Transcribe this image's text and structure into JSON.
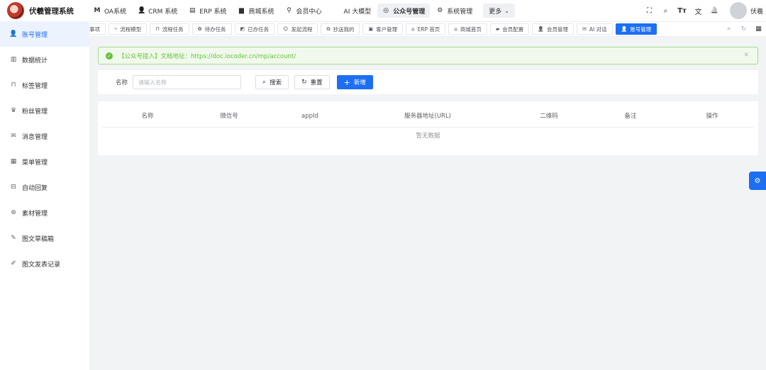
{
  "app": {
    "title": "伏羲管理系统"
  },
  "topnav": [
    {
      "icon": "m-icon",
      "glyph": "M",
      "label": "OA系统",
      "active": false
    },
    {
      "icon": "user-icon",
      "glyph": "👤",
      "label": "CRM 系统",
      "active": false
    },
    {
      "icon": "calendar-icon",
      "glyph": "▤",
      "label": "ERP 系统",
      "active": false
    },
    {
      "icon": "shop-icon",
      "glyph": "▆",
      "label": "商城系统",
      "active": false
    },
    {
      "icon": "bike-icon",
      "glyph": "⚲",
      "label": "会员中心",
      "active": false
    },
    {
      "icon": "apple-icon",
      "glyph": "",
      "label": "AI 大模型",
      "active": false
    },
    {
      "icon": "compass-icon",
      "glyph": "◎",
      "label": "公众号管理",
      "active": true
    },
    {
      "icon": "gear-icon",
      "glyph": "⚙",
      "label": "系统管理",
      "active": false
    }
  ],
  "more_label": "更多",
  "toolbar": {
    "fullscreen_glyph": "⛶",
    "search_glyph": "⌕",
    "font_glyph": "Tт",
    "translate_glyph": "文",
    "bell_glyph": "🔔",
    "username": "伏羲"
  },
  "sidebar": [
    {
      "icon": "user-icon",
      "glyph": "👤",
      "label": "账号管理",
      "active": true
    },
    {
      "icon": "chart-icon",
      "glyph": "▥",
      "label": "数据统计",
      "active": false
    },
    {
      "icon": "bookmark-icon",
      "glyph": "⊓",
      "label": "标签管理",
      "active": false
    },
    {
      "icon": "fans-icon",
      "glyph": "♛",
      "label": "粉丝管理",
      "active": false
    },
    {
      "icon": "mail-icon",
      "glyph": "✉",
      "label": "消息管理",
      "active": false
    },
    {
      "icon": "grid-icon",
      "glyph": "▦",
      "label": "菜单管理",
      "active": false
    },
    {
      "icon": "car-icon",
      "glyph": "⊟",
      "label": "自动回复",
      "active": false
    },
    {
      "icon": "aperture-icon",
      "glyph": "⊛",
      "label": "素材管理",
      "active": false
    },
    {
      "icon": "edit-box-icon",
      "glyph": "✎",
      "label": "图文草稿箱",
      "active": false
    },
    {
      "icon": "pen-icon",
      "glyph": "✐",
      "label": "图文发表记录",
      "active": false
    }
  ],
  "tabs": [
    {
      "icon": "",
      "glyph": "",
      "label": "事项",
      "active": false,
      "first": true
    },
    {
      "icon": "flow-icon",
      "glyph": "⑂",
      "label": "流程模型",
      "active": false
    },
    {
      "icon": "bookmark-icon",
      "glyph": "⊓",
      "label": "流程任务",
      "active": false
    },
    {
      "icon": "todo-icon",
      "glyph": "✿",
      "label": "待办任务",
      "active": false
    },
    {
      "icon": "done-icon",
      "glyph": "◩",
      "label": "已办任务",
      "active": false
    },
    {
      "icon": "smile-icon",
      "glyph": "☺",
      "label": "发起流程",
      "active": false
    },
    {
      "icon": "copy-icon",
      "glyph": "⧉",
      "label": "抄送我的",
      "active": false
    },
    {
      "icon": "customer-icon",
      "glyph": "▣",
      "label": "客户管理",
      "active": false
    },
    {
      "icon": "home-icon",
      "glyph": "⌂",
      "label": "ERP 首页",
      "active": false
    },
    {
      "icon": "home-icon",
      "glyph": "⌂",
      "label": "商城首页",
      "active": false
    },
    {
      "icon": "box-icon",
      "glyph": "▰",
      "label": "会员配置",
      "active": false
    },
    {
      "icon": "user-icon",
      "glyph": "👤",
      "label": "会员管理",
      "active": false
    },
    {
      "icon": "chat-icon",
      "glyph": "✉",
      "label": "AI 对话",
      "active": false
    },
    {
      "icon": "user-icon",
      "glyph": "👤",
      "label": "账号管理",
      "active": true
    }
  ],
  "tabs_tools": {
    "next_glyph": "»",
    "refresh_glyph": "↻",
    "grid_glyph": "▦"
  },
  "alert": {
    "text": "【公众号接入】文档地址：https://doc.iocoder.cn/mp/account/",
    "check_glyph": "✓",
    "close_glyph": "✕"
  },
  "search": {
    "name_label": "名称",
    "name_placeholder": "请输入名称",
    "search_label": "搜索",
    "search_glyph": "⌕",
    "reset_label": "重置",
    "reset_glyph": "↻",
    "add_label": "新增",
    "add_glyph": "+"
  },
  "table": {
    "columns": [
      "名称",
      "微信号",
      "appId",
      "服务器地址(URL)",
      "二维码",
      "备注",
      "操作"
    ],
    "empty_text": "暂无数据"
  },
  "float_glyph": "⚙",
  "colors": {
    "primary": "#1d6ff2",
    "success": "#67c23a",
    "success_bg": "#f0f9eb"
  }
}
